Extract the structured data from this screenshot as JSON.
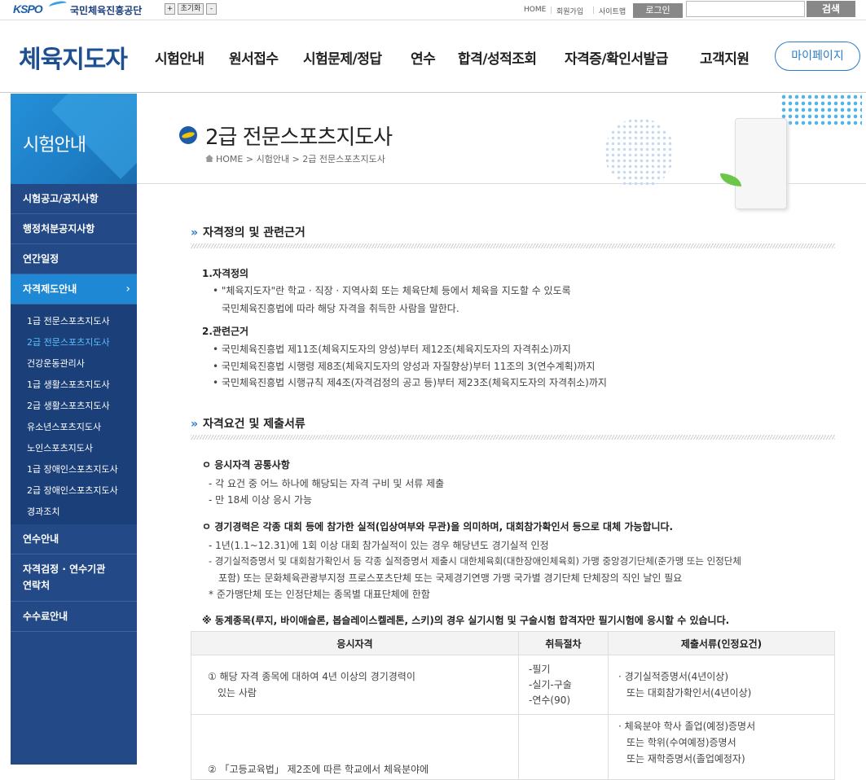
{
  "topbar": {
    "logo_text": "KSPO",
    "org_name": "국민체육진흥공단",
    "font_plus": "+",
    "font_reset": "초기화",
    "font_minus": "-",
    "home": "HOME",
    "join": "회원가입",
    "sitemap": "사이트맵",
    "login": "로그인",
    "search_value": "",
    "search_button": "검색"
  },
  "gnb": {
    "brand": "체육지도자",
    "menus": [
      "시험안내",
      "원서접수",
      "시험문제/정답",
      "연수",
      "합격/성적조회",
      "자격증/확인서발급",
      "고객지원"
    ],
    "mypage": "마이페이지"
  },
  "sidebar": {
    "title": "시험안내",
    "items": [
      "시험공고/공지사항",
      "행정처분공지사항",
      "연간일정",
      "자격제도안내",
      "연수안내",
      "자격검정 · 연수기관",
      "연락처",
      "수수료안내"
    ],
    "sub_items": [
      "1급 전문스포츠지도사",
      "2급 전문스포츠지도사",
      "건강운동관리사",
      "1급 생활스포츠지도사",
      "2급 생활스포츠지도사",
      "유소년스포츠지도사",
      "노인스포츠지도사",
      "1급 장애인스포츠지도사",
      "2급 장애인스포츠지도사",
      "경과조치"
    ]
  },
  "page": {
    "title": "2급 전문스포츠지도사",
    "breadcrumb_home": "HOME",
    "breadcrumb_1": "시험안내",
    "breadcrumb_2": "2급 전문스포츠지도사"
  },
  "section1": {
    "heading": "자격정의 및 관련근거",
    "h1": "1.자격정의",
    "def_line1": "\"체육지도자\"란 학교 · 직장 · 지역사회 또는 체육단체 등에서 체육을 지도할 수 있도록",
    "def_line2": "국민체육진흥법에 따라 해당 자격을 취득한 사람을 말한다.",
    "h2": "2.관련근거",
    "law1": "국민체육진흥법 제11조(체육지도자의 양성)부터 제12조(체육지도자의 자격취소)까지",
    "law2": "국민체육진흥법 시행령 제8조(체육지도자의 양성과 자질향상)부터 11조의 3(연수계획)까지",
    "law3": "국민체육진흥법 시행규칙 제4조(자격검정의 공고 등)부터 제23조(체육지도자의 자격취소)까지"
  },
  "section2": {
    "heading": "자격요건 및 제출서류",
    "common_title": "응시자격 공통사항",
    "common1": "- 각 요건 중 어느 하나에 해당되는 자격 구비 및 서류 제출",
    "common2": "- 만 18세 이상 응시 가능",
    "career_title": "경기경력은 각종 대회 등에 참가한 실적(입상여부와 무관)을 의미하며, 대회참가확인서 등으로 대체 가능합니다.",
    "career1": "- 1년(1.1~12.31)에 1회 이상 대회 참가실적이 있는 경우 해당년도 경기실적 인정",
    "career2a": "- 경기실적증명서 및 대회참가확인서 등 각종 실적증명서 제출시 대한체육회(대한장애인체육회) 가맹 중앙경기단체(준가맹 또는 인정단체",
    "career2b": "포함) 또는 문화체육관광부지정 프로스포츠단체 또는 국제경기연맹 가맹 국가별 경기단체 단체장의 직인 날인 필요",
    "career3": "* 준가맹단체 또는 인정단체는 종목별 대표단체에 한함",
    "winter_note": "※ 동계종목(루지, 바이애슬론, 봅슬레이스켈레톤, 스키)의 경우 실기시험 및 구술시험 합격자만 필기시험에 응시할 수 있습니다."
  },
  "table": {
    "headers": [
      "응시자격",
      "취득절차",
      "제출서류(인정요건)"
    ],
    "row1": {
      "qual_a": "① 해당 자격 종목에 대하여 4년 이상의 경기경력이",
      "qual_b": "있는 사람",
      "proc_a": "-필기",
      "proc_b": "-실기-구술",
      "proc_c": "-연수(90)",
      "docs_a": "· 경기실적증명서(4년이상)",
      "docs_b": "또는 대회참가확인서(4년이상)"
    },
    "row2": {
      "qual_a": "② 「고등교육법」 제2조에 따른 학교에서 체육분야에",
      "docs_a": "· 체육분야 학사 졸업(예정)증명서",
      "docs_b": "또는 학위(수여예정)증명서",
      "docs_c": "또는 재학증명서(졸업예정자)"
    }
  },
  "colors": {
    "accent": "#2a7bc8",
    "sidebar": "#234a87",
    "sidebar_active": "#1e88d4"
  }
}
